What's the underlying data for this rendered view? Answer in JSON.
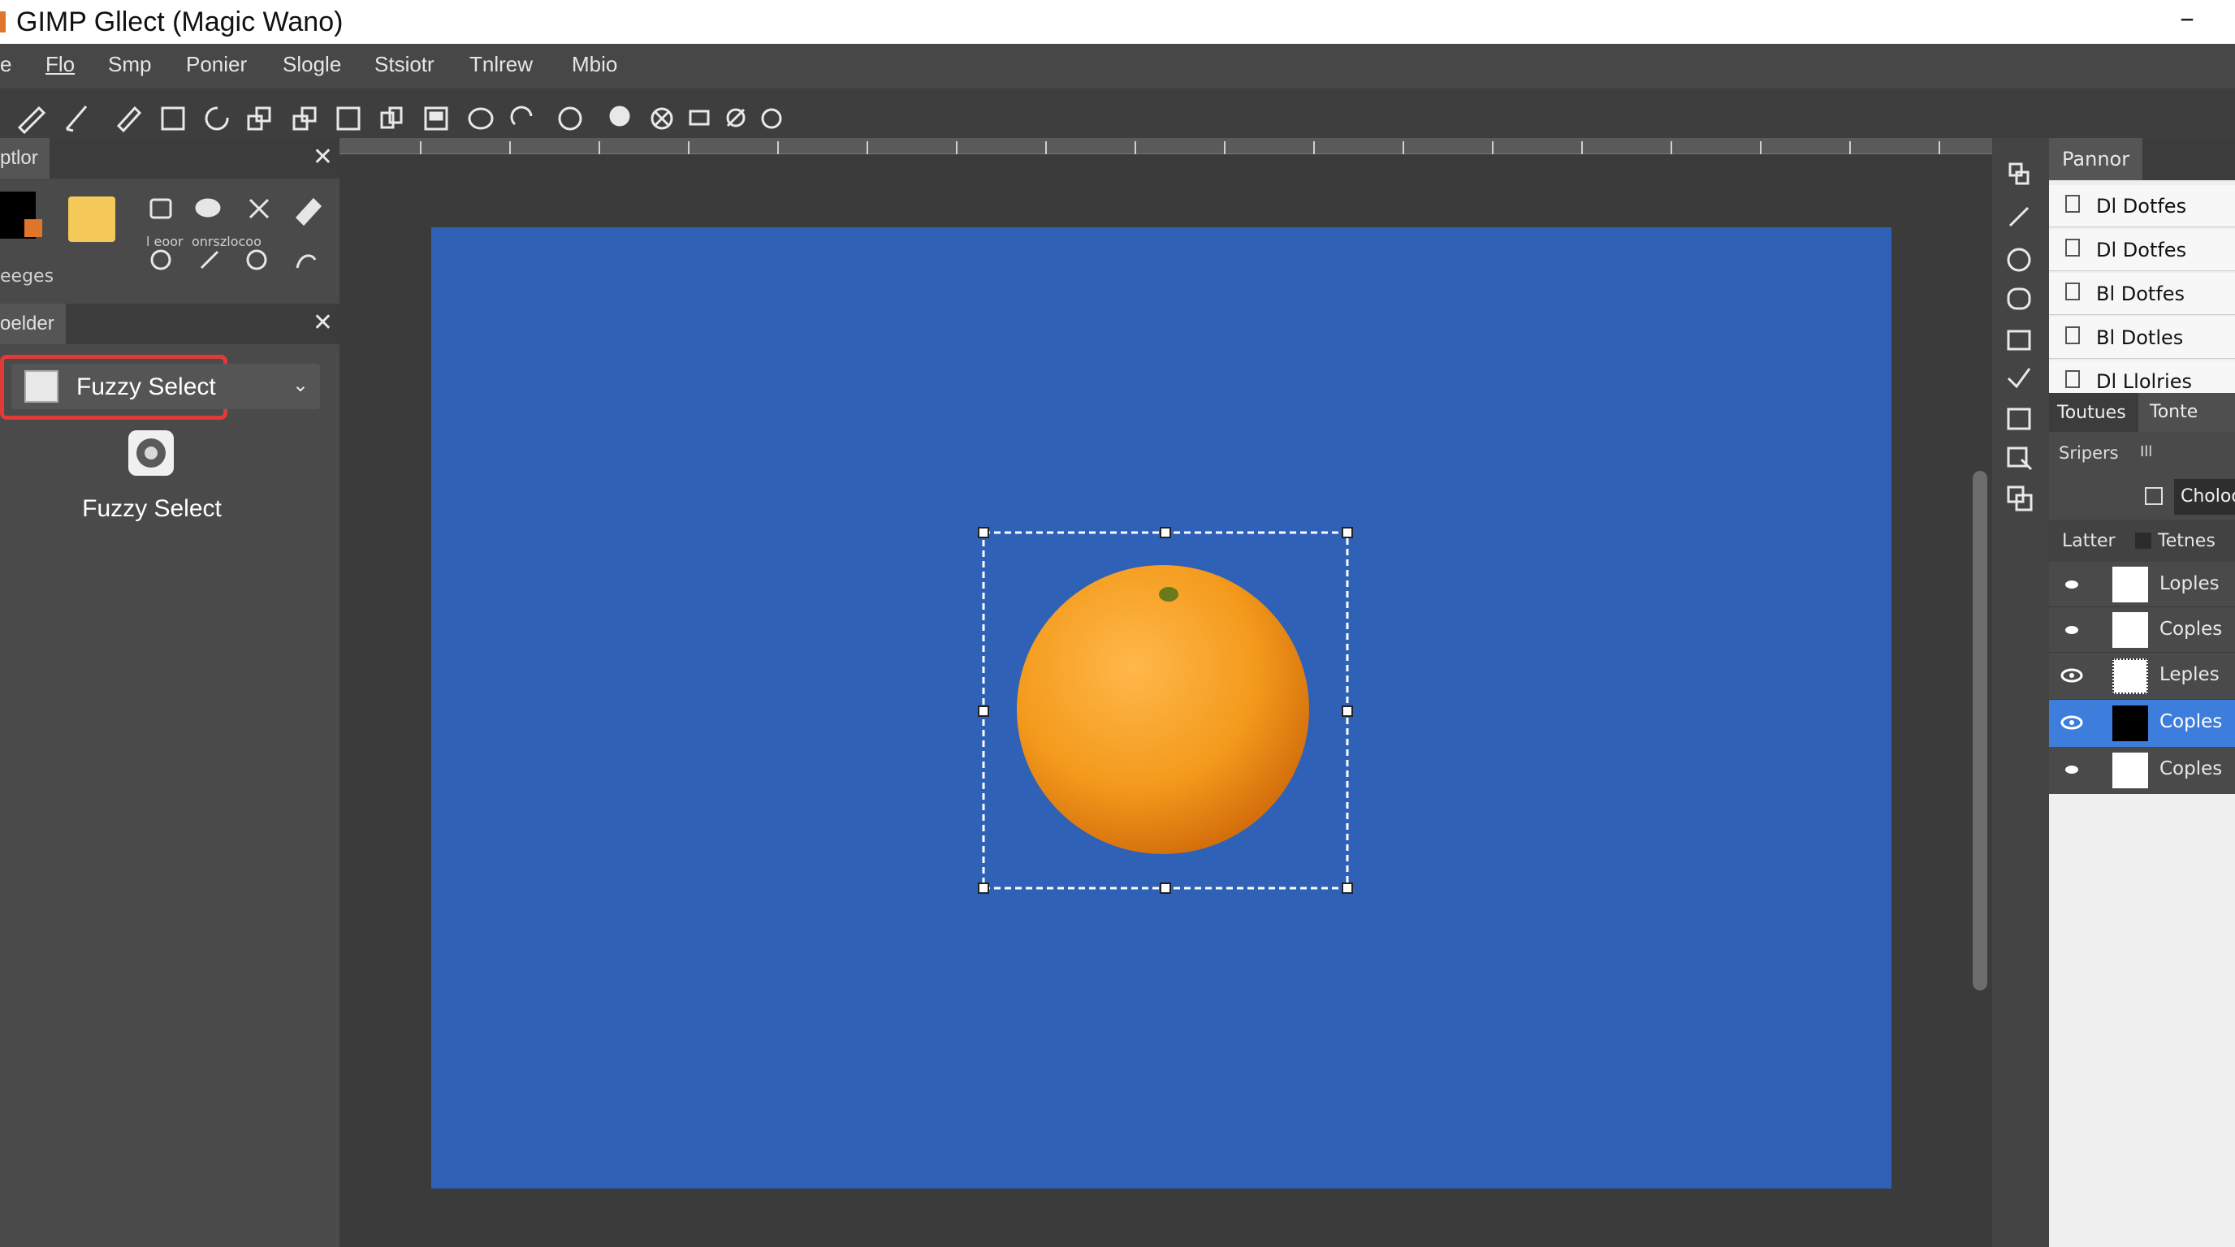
{
  "window": {
    "title": "GIMP Gllect (Magic Wano)",
    "minimize": "–"
  },
  "menu": [
    "e",
    "Flo",
    "Smp",
    "Ponier",
    "Slogle",
    "Stsiotr",
    "Tnlrew",
    "Mbio"
  ],
  "left_panel": {
    "top_tab": "ptlor",
    "images_label": "eeges",
    "brush_labels": [
      "l eoor",
      "onrszlocoo"
    ],
    "tool_tab": "oelder",
    "tool_select_value": "Fuzzy Select",
    "tool_name": "Fuzzy Select",
    "close": "✕"
  },
  "right_dock": {
    "panel_tab": "Pannor",
    "list_items": [
      "Dl Dotfes",
      "Dl Dotfes",
      "Bl Dotfes",
      "Bl Dotles",
      "Dl Llolries"
    ],
    "tabs": [
      "Toutues",
      "Tonte"
    ],
    "stripes_label": "Sripers",
    "stripes_value": "Ill",
    "chooser_label": "Choloo",
    "layers_label": "Latter",
    "textures_label": "Tetnes",
    "layers": [
      {
        "name": "Loples",
        "selected": false,
        "thumb": "white"
      },
      {
        "name": "Coples",
        "selected": false,
        "thumb": "white"
      },
      {
        "name": "Leples",
        "selected": false,
        "thumb": "grid"
      },
      {
        "name": "Coples",
        "selected": true,
        "thumb": "black"
      },
      {
        "name": "Coples",
        "selected": false,
        "thumb": "white"
      }
    ]
  },
  "colors": {
    "canvas_blue": "#2f61b6",
    "orange": "#f39a1c",
    "selected_row": "#3d7ddb",
    "highlight_box": "#e03a3a",
    "fg_color": "#000000",
    "bg_color": "#f5c85a"
  }
}
